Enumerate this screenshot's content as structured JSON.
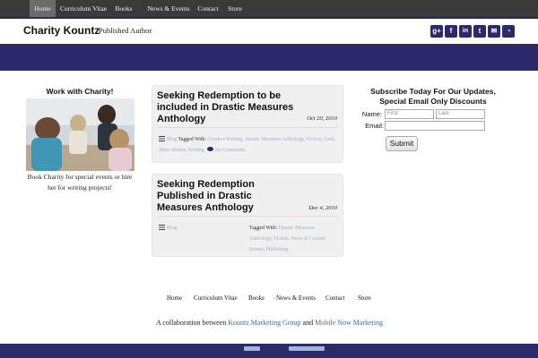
{
  "topnav": {
    "items": [
      {
        "label": "Home",
        "active": true
      },
      {
        "label": "Curriculum Vitae",
        "active": false
      },
      {
        "label": "Books",
        "active": false
      },
      {
        "label": "News & Events",
        "active": false
      },
      {
        "label": "Contact",
        "active": false
      },
      {
        "label": "Store",
        "active": false
      }
    ]
  },
  "header": {
    "title": "Charity Kountz",
    "tagline": "Published Author",
    "social": [
      {
        "icon": "google-plus-icon",
        "glyph": "g+"
      },
      {
        "icon": "facebook-icon",
        "glyph": "f"
      },
      {
        "icon": "linkedin-icon",
        "glyph": "in"
      },
      {
        "icon": "twitter-icon",
        "glyph": "t"
      },
      {
        "icon": "email-icon",
        "glyph": "✉"
      },
      {
        "icon": "rss-icon",
        "glyph": "◔"
      }
    ]
  },
  "left_sidebar": {
    "title": "Work with Charity!",
    "description": "Book Charity for special events or hire her for writing projects!"
  },
  "posts": [
    {
      "title": "Seeking Redemption to be included in Drastic Measures Anthology",
      "date": "Oct 20, 2010",
      "category": "Blog",
      "tagged_label": "Tagged With:",
      "tags": "Creative Writing, Drastic Measures Anthology, Fiction, Grok, Short Stories, Writing",
      "comments": "No Comments"
    },
    {
      "title": "Seeking Redemption Published in Drastic Measures Anthology",
      "date": "Dec 4, 2010",
      "category": "Blog",
      "tagged_label": "Tagged With:",
      "tags": "Drastic Measures Anthology, Fiction, News & Current Events, Publishing"
    }
  ],
  "subscribe": {
    "title": "Subscribe Today For Our Updates, Special Email Only Discounts",
    "name_label": "Name:",
    "first_placeholder": "First",
    "last_placeholder": "Last",
    "email_label": "Email:",
    "submit_label": "Submit"
  },
  "footer": {
    "nav": [
      "Home",
      "Curriculum Vitae",
      "Books",
      "News & Events",
      "Contact",
      "Store"
    ],
    "collab_prefix": "A collaboration between",
    "collab_link1": "Kountz Marketing Group",
    "collab_and": "and",
    "collab_link2": "Mobile Now Marketing"
  },
  "colors": {
    "brand_navy": "#2c2a6a",
    "nav_dark": "#3a3a3a",
    "link_blue": "#3d6a9f"
  }
}
